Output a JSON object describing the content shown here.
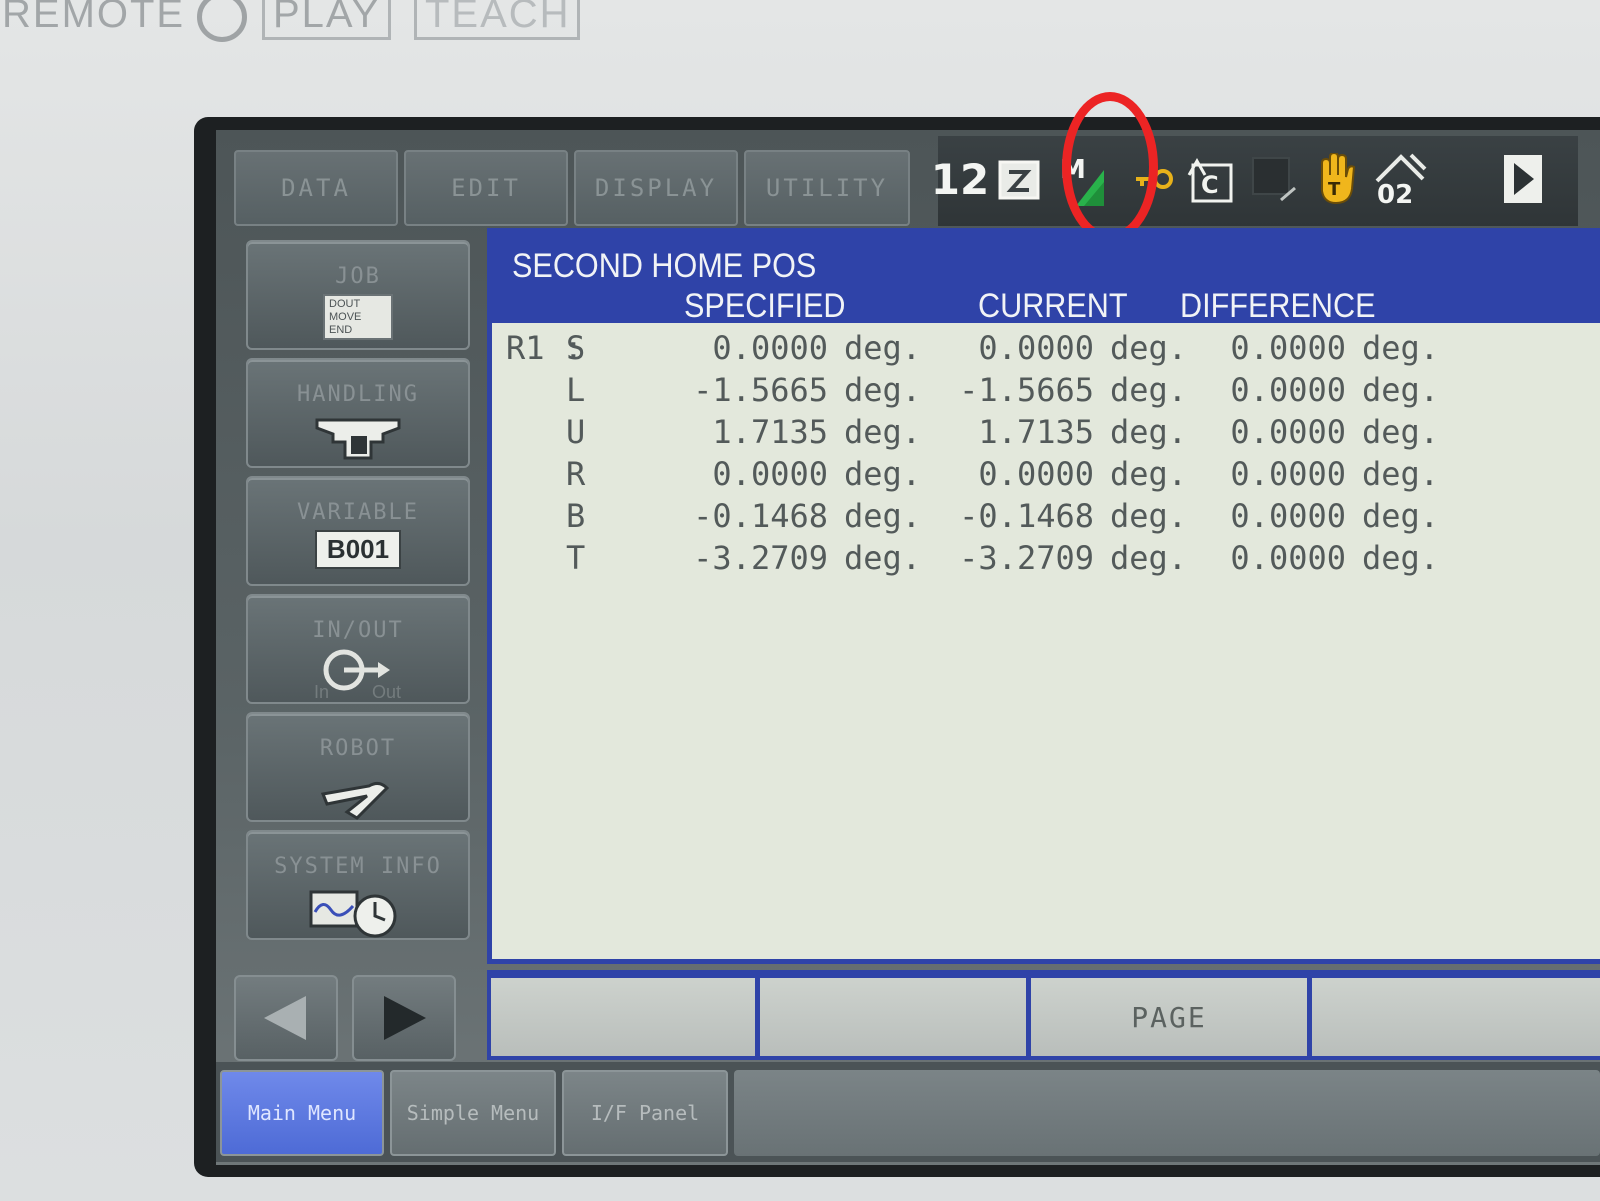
{
  "casing": {
    "remote": "REMOTE",
    "play": "PLAY",
    "teach": "TEACH"
  },
  "top_menu": [
    "DATA",
    "EDIT",
    "DISPLAY",
    "UTILITY"
  ],
  "status_icons": {
    "group_axis": "12",
    "motion": "M",
    "security_number": "02",
    "icons": [
      "group-axis-icon",
      "edit-mode-icon",
      "machine-lock-icon",
      "security-key-icon",
      "cycle-icon",
      "coordinate-icon",
      "servo-hand-icon",
      "security-level-icon",
      "next-arrow-icon"
    ]
  },
  "highlight_color": "#ec2424",
  "side_menu": [
    {
      "label": "JOB",
      "icon_text": "DOUT\nMOVE\nEND"
    },
    {
      "label": "HANDLING"
    },
    {
      "label": "VARIABLE",
      "icon_text": "B001"
    },
    {
      "label": "IN/OUT",
      "icon_in": "In",
      "icon_out": "Out"
    },
    {
      "label": "ROBOT"
    },
    {
      "label": "SYSTEM INFO"
    }
  ],
  "panel": {
    "title": "SECOND HOME POS",
    "columns": [
      "SPECIFIED",
      "CURRENT",
      "DIFFERENCE"
    ],
    "group": "R1 :",
    "unit": "deg.",
    "rows": [
      {
        "axis": "S",
        "specified": "0.0000",
        "current": "0.0000",
        "difference": "0.0000"
      },
      {
        "axis": "L",
        "specified": "-1.5665",
        "current": "-1.5665",
        "difference": "0.0000"
      },
      {
        "axis": "U",
        "specified": "1.7135",
        "current": "1.7135",
        "difference": "0.0000"
      },
      {
        "axis": "R",
        "specified": "0.0000",
        "current": "0.0000",
        "difference": "0.0000"
      },
      {
        "axis": "B",
        "specified": "-0.1468",
        "current": "-0.1468",
        "difference": "0.0000"
      },
      {
        "axis": "T",
        "specified": "-3.2709",
        "current": "-3.2709",
        "difference": "0.0000"
      }
    ]
  },
  "function_keys": [
    "",
    "",
    "PAGE",
    ""
  ],
  "bottom_tabs": [
    "Main Menu",
    "Simple Menu",
    "I/F Panel"
  ],
  "colors": {
    "panel_blue": "#2f43a8",
    "panel_bg": "#e3e8dc",
    "active_tab": "#4e6bd6"
  }
}
